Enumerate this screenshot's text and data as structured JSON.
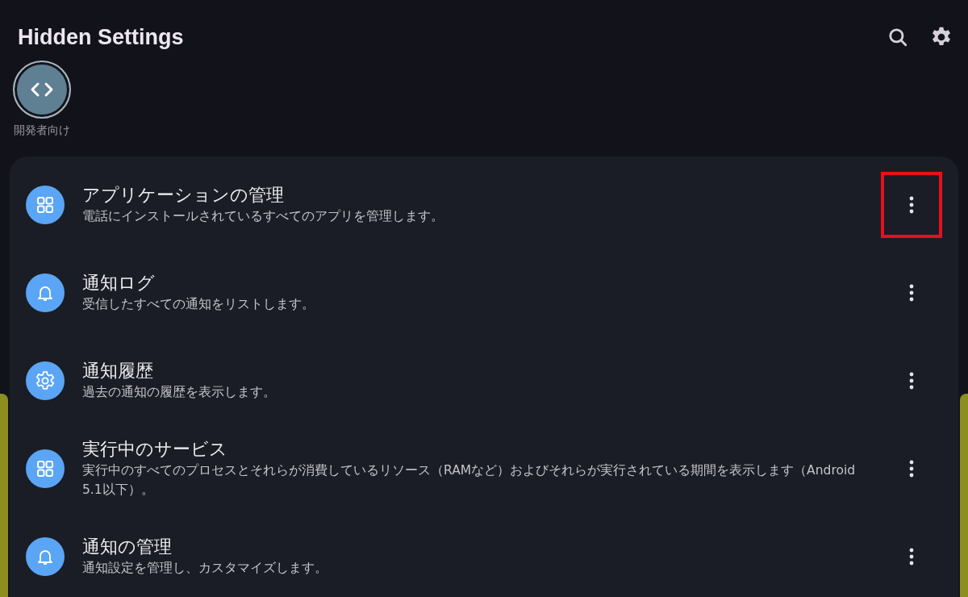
{
  "header": {
    "title": "Hidden Settings"
  },
  "shortcuts": [
    {
      "label": "開発者向け",
      "kind": "code"
    }
  ],
  "items": [
    {
      "title": "アプリケーションの管理",
      "subtitle": "電話にインストールされているすべてのアプリを管理します。",
      "kind": "grid",
      "highlighted": true
    },
    {
      "title": "通知ログ",
      "subtitle": "受信したすべての通知をリストします。",
      "kind": "bell",
      "highlighted": false
    },
    {
      "title": "通知履歴",
      "subtitle": "過去の通知の履歴を表示します。",
      "kind": "gear",
      "highlighted": false
    },
    {
      "title": "実行中のサービス",
      "subtitle": "実行中のすべてのプロセスとそれらが消費しているリソース（RAMなど）およびそれらが実行されている期間を表示します（Android 5.1以下）。",
      "kind": "grid",
      "highlighted": false
    },
    {
      "title": "通知の管理",
      "subtitle": "通知設定を管理し、カスタマイズします。",
      "kind": "bell",
      "highlighted": false
    }
  ]
}
